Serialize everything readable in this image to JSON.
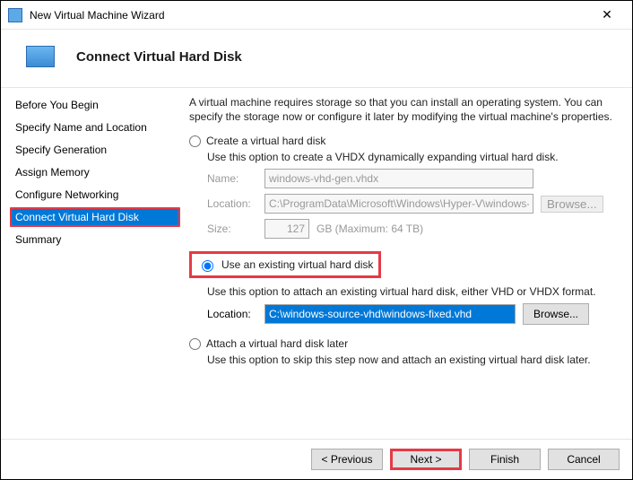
{
  "window": {
    "title": "New Virtual Machine Wizard"
  },
  "header": {
    "title": "Connect Virtual Hard Disk"
  },
  "sidebar": {
    "steps": [
      {
        "label": "Before You Begin"
      },
      {
        "label": "Specify Name and Location"
      },
      {
        "label": "Specify Generation"
      },
      {
        "label": "Assign Memory"
      },
      {
        "label": "Configure Networking"
      },
      {
        "label": "Connect Virtual Hard Disk"
      },
      {
        "label": "Summary"
      }
    ],
    "active_index": 5
  },
  "main": {
    "intro": "A virtual machine requires storage so that you can install an operating system. You can specify the storage now or configure it later by modifying the virtual machine's properties.",
    "opt_create": {
      "label": "Create a virtual hard disk",
      "desc": "Use this option to create a VHDX dynamically expanding virtual hard disk.",
      "name_label": "Name:",
      "name_value": "windows-vhd-gen.vhdx",
      "loc_label": "Location:",
      "loc_value": "C:\\ProgramData\\Microsoft\\Windows\\Hyper-V\\windows-vhd-gen\\Vir",
      "browse": "Browse...",
      "size_label": "Size:",
      "size_value": "127",
      "size_suffix": "GB (Maximum: 64 TB)"
    },
    "opt_existing": {
      "label": "Use an existing virtual hard disk",
      "desc": "Use this option to attach an existing virtual hard disk, either VHD or VHDX format.",
      "loc_label": "Location:",
      "loc_value": "C:\\windows-source-vhd\\windows-fixed.vhd",
      "browse": "Browse..."
    },
    "opt_later": {
      "label": "Attach a virtual hard disk later",
      "desc": "Use this option to skip this step now and attach an existing virtual hard disk later."
    }
  },
  "footer": {
    "previous": "< Previous",
    "next": "Next >",
    "finish": "Finish",
    "cancel": "Cancel"
  }
}
